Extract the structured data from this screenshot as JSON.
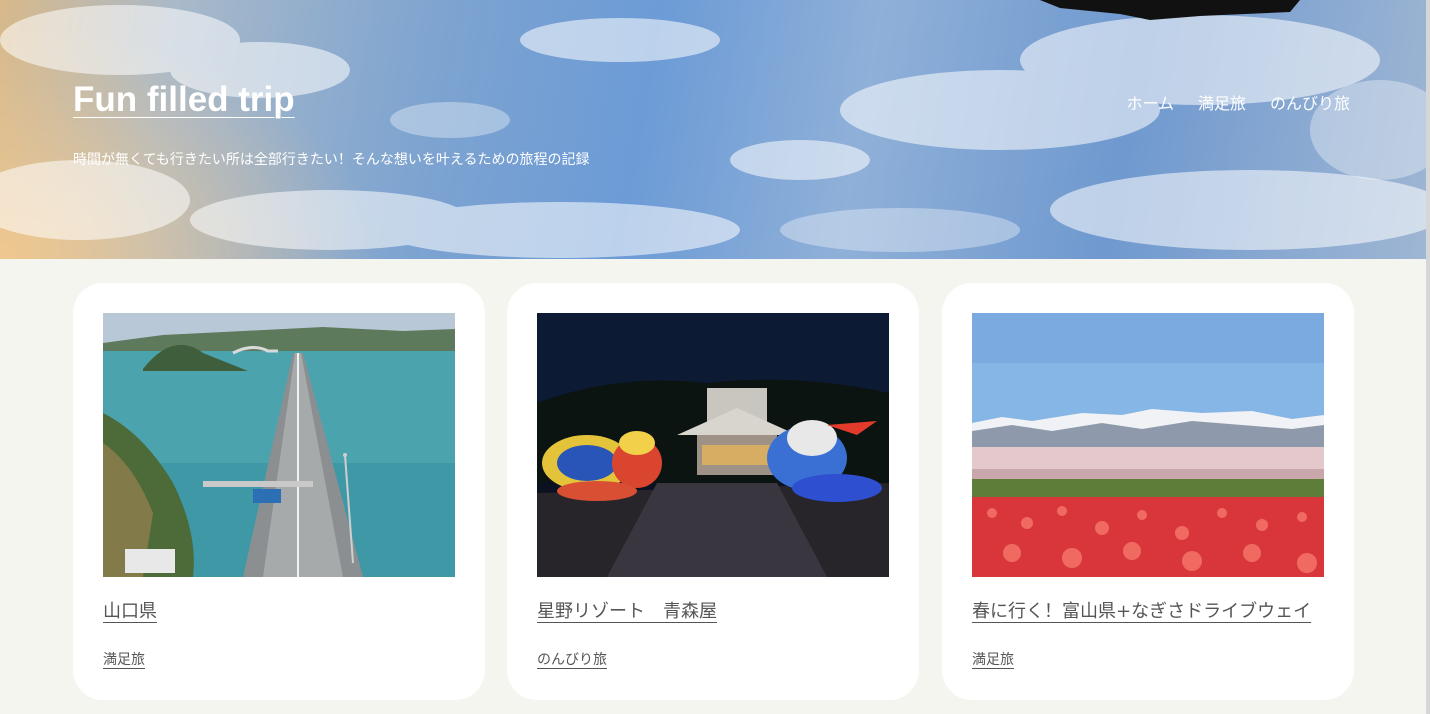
{
  "site": {
    "title": "Fun filled trip",
    "tagline": "時間が無くても行きたい所は全部行きたい！そんな想いを叶えるための旅程の記録"
  },
  "nav": {
    "items": [
      "ホーム",
      "満足旅",
      "のんびり旅"
    ]
  },
  "posts": [
    {
      "title": "山口県",
      "category": "満足旅",
      "image": "bridge-over-sea-photo"
    },
    {
      "title": "星野リゾート　青森屋",
      "category": "のんびり旅",
      "image": "nebuta-lanterns-night-photo"
    },
    {
      "title": "春に行く！富山県+なぎさドライブウェイ",
      "category": "満足旅",
      "image": "tulip-field-mountains-photo"
    }
  ],
  "colors": {
    "background": "#f5f5f0",
    "card": "#ffffff",
    "text": "#555555",
    "hero_text": "#ffffff"
  }
}
